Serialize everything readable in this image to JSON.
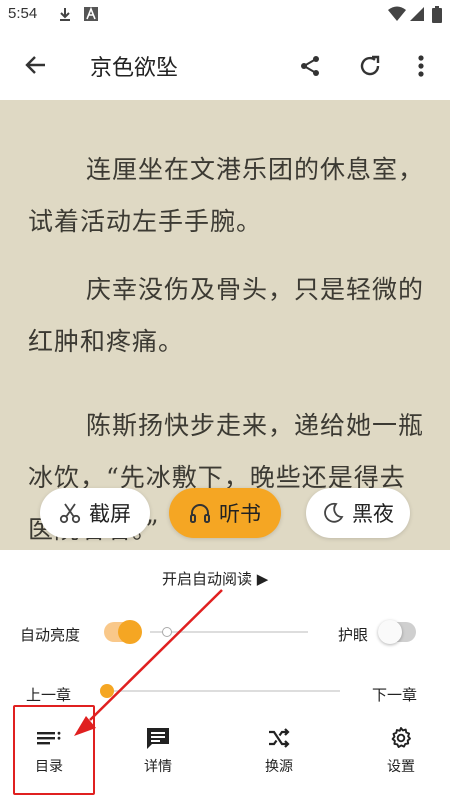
{
  "status_bar": {
    "time": "5:54",
    "icons": [
      "download-icon",
      "a-box-icon",
      "wifi-icon",
      "signal-icon",
      "battery-icon"
    ]
  },
  "app_bar": {
    "title": "京色欲坠",
    "icons": [
      "back-arrow-icon",
      "share-icon",
      "refresh-icon",
      "more-vert-icon"
    ]
  },
  "reader": {
    "paragraphs": [
      "连厘坐在文港乐团的休息室，试着活动左手手腕。",
      "庆幸没伤及骨头，只是轻微的红肿和疼痛。",
      "陈斯扬快步走来，递给她一瓶冰饮，“先冰敷下，晚些还是得去医院看看。”"
    ]
  },
  "chips": {
    "screenshot": "截屏",
    "listen": "听书",
    "night": "黑夜"
  },
  "panel": {
    "auto_read": "开启自动阅读 ▶",
    "auto_brightness": "自动亮度",
    "eye_care": "护眼",
    "prev_chapter": "上一章",
    "next_chapter": "下一章",
    "brightness_level": 0.08,
    "chapter_progress": 0.0
  },
  "tabs": {
    "catalog": "目录",
    "detail": "详情",
    "source": "换源",
    "settings": "设置"
  },
  "colors": {
    "accent": "#f5a623",
    "reader_bg": "#dfd9c4",
    "annotation": "#e02020"
  }
}
